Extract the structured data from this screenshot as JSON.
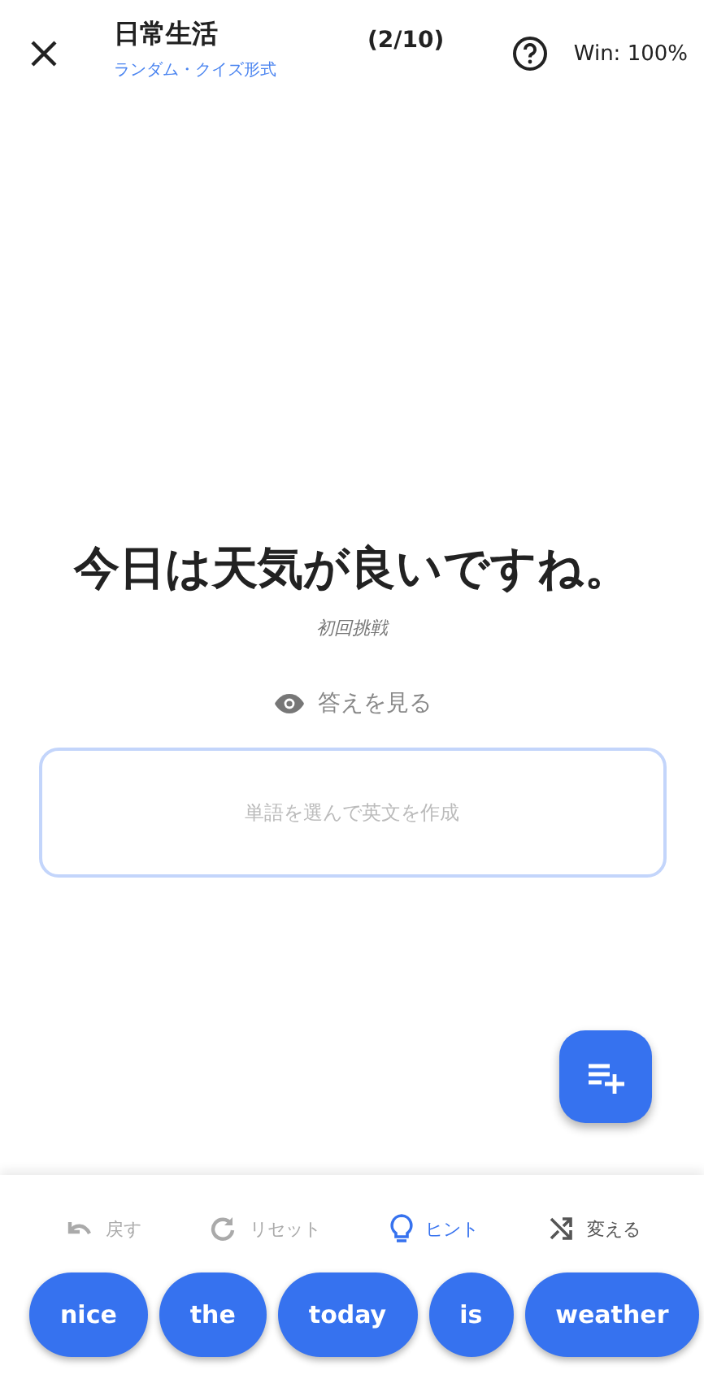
{
  "header": {
    "title": "日常生活",
    "subtitle": "ランダム・クイズ形式",
    "progress": "(2/10)",
    "win_rate": "Win: 100%"
  },
  "question": {
    "sentence": "今日は天気が良いですね。",
    "attempt": "初回挑戦",
    "reveal": "答えを見る"
  },
  "answer": {
    "placeholder": "単語を選んで英文を作成"
  },
  "actions": [
    {
      "kind": "undo",
      "label": "戻す",
      "disabled": true,
      "active": false
    },
    {
      "kind": "reset",
      "label": "リセット",
      "disabled": true,
      "active": false
    },
    {
      "kind": "hint",
      "label": "ヒント",
      "disabled": false,
      "active": true
    },
    {
      "kind": "shuffle",
      "label": "変える",
      "disabled": false,
      "active": false
    }
  ],
  "words": [
    "nice",
    "the",
    "today",
    "is",
    "weather"
  ]
}
